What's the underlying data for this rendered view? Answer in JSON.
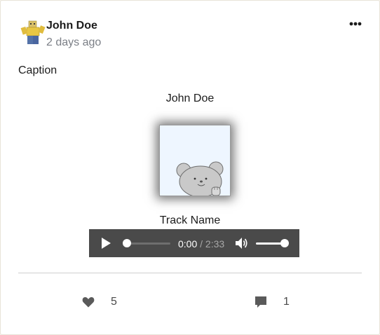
{
  "post": {
    "author": "John Doe",
    "timestamp": "2 days ago",
    "caption": "Caption",
    "menu_icon": "ellipsis-icon",
    "avatar_icon": "roblox-character-avatar"
  },
  "media": {
    "artist": "John Doe",
    "track_name": "Track Name",
    "cover_icon": "cartoon-bear-cover-art",
    "player": {
      "current_time": "0:00",
      "separator": "/",
      "duration": "2:33",
      "progress": 0.0,
      "volume": 1.0
    }
  },
  "actions": {
    "likes": "5",
    "comments": "1",
    "like_icon": "heart-icon",
    "comment_icon": "comment-icon"
  },
  "colors": {
    "player_bg": "#4a4a4a",
    "timestamp": "#7b7f86",
    "icon_gray": "#5a5a5a"
  }
}
